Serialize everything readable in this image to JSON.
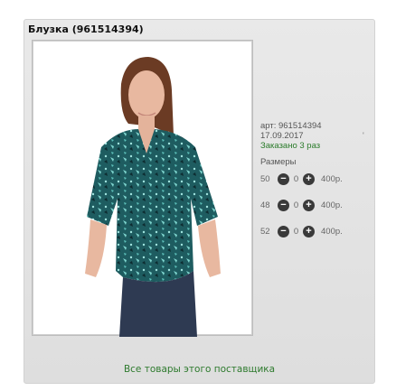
{
  "product": {
    "title": "Блузка (961514394)",
    "article": "арт: 961514394",
    "date": "17.09.2017",
    "date_mark": "'",
    "ordered": "Заказано 3 раз",
    "sizes_label": "Размеры",
    "sizes": [
      {
        "size": "50",
        "qty": "0",
        "price": "400р."
      },
      {
        "size": "48",
        "qty": "0",
        "price": "400р."
      },
      {
        "size": "52",
        "qty": "0",
        "price": "400р."
      }
    ],
    "minus_symbol": "−",
    "plus_symbol": "+"
  },
  "footer": {
    "supplier_link": "Все товары этого поставщика"
  },
  "colors": {
    "link_green": "#2d7a2d",
    "blouse": "#1f5f63",
    "button": "#3a3a3a"
  }
}
